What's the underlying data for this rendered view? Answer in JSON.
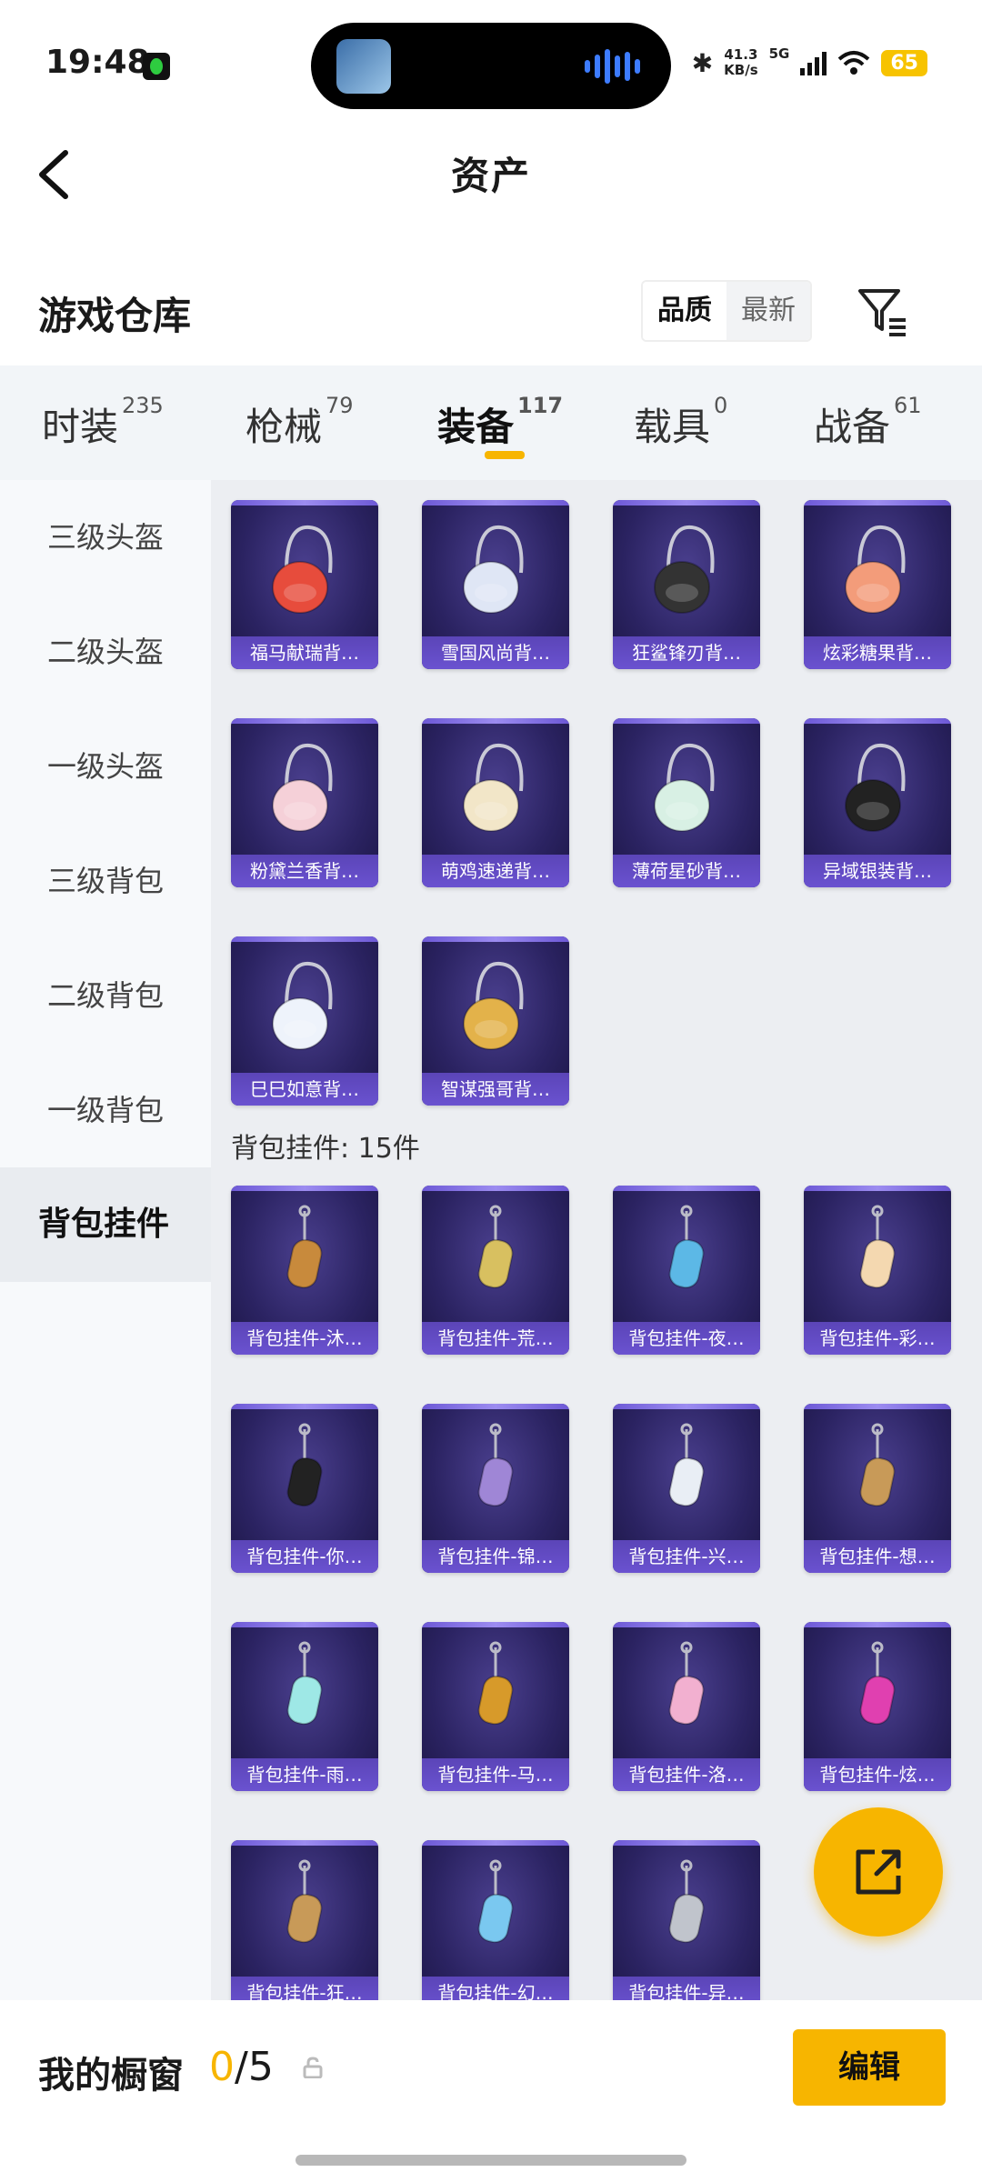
{
  "status_bar": {
    "time": "19:48",
    "speed_value": "41.3",
    "speed_unit": "KB/s",
    "network": "5G",
    "battery": "65"
  },
  "header": {
    "title": "资产"
  },
  "warehouse": {
    "title": "游戏仓库",
    "sort_options": [
      "品质",
      "最新"
    ],
    "sort_selected": "品质"
  },
  "tabs": [
    {
      "label": "时装",
      "count": "235"
    },
    {
      "label": "枪械",
      "count": "79"
    },
    {
      "label": "装备",
      "count": "117"
    },
    {
      "label": "载具",
      "count": "0"
    },
    {
      "label": "战备",
      "count": "61"
    }
  ],
  "active_tab": "装备",
  "sidenav": [
    "三级头盔",
    "二级头盔",
    "一级头盔",
    "三级背包",
    "二级背包",
    "一级背包",
    "背包挂件"
  ],
  "active_nav": "背包挂件",
  "backpacks": [
    "福马献瑞背…",
    "雪国风尚背…",
    "狂鲨锋刃背…",
    "炫彩糖果背…",
    "粉黛兰香背…",
    "萌鸡速递背…",
    "薄荷星砂背…",
    "异域银装背…",
    "巳巳如意背…",
    "智谋强哥背…"
  ],
  "section_label": "背包挂件: 15件",
  "pendants": [
    "背包挂件-沐…",
    "背包挂件-荒…",
    "背包挂件-夜…",
    "背包挂件-彩…",
    "背包挂件-你…",
    "背包挂件-锦…",
    "背包挂件-兴…",
    "背包挂件-想…",
    "背包挂件-雨…",
    "背包挂件-马…",
    "背包挂件-洛…",
    "背包挂件-炫…",
    "背包挂件-狂…",
    "背包挂件-幻…",
    "背包挂件-异…"
  ],
  "bottom": {
    "title": "我的橱窗",
    "count_current": "0",
    "count_sep": "/",
    "count_total": "5",
    "edit_label": "编辑"
  },
  "icons": {
    "back": "chevron-left-icon",
    "filter": "filter-icon",
    "fab": "share-external-icon",
    "lock": "lock-icon"
  },
  "colors": {
    "accent": "#f7b500",
    "card_bg": "#2b2362",
    "card_caption": "#6a52d0"
  }
}
